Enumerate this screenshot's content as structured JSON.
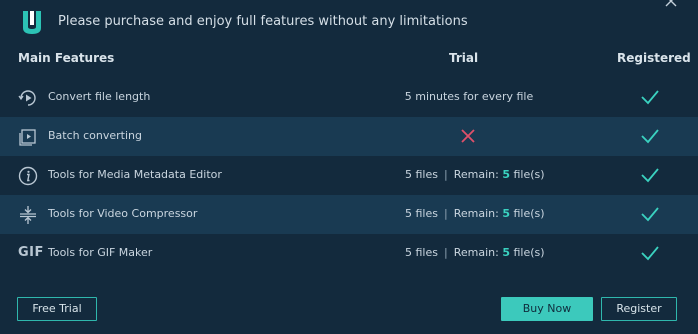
{
  "header": {
    "message": "Please purchase and enjoy full features without any limitations",
    "logo_icon": "app-logo-icon",
    "close_icon": "close-icon"
  },
  "columns": {
    "main": "Main Features",
    "trial": "Trial",
    "registered": "Registered"
  },
  "rows": [
    {
      "label": "Convert file length",
      "icon": "play-circle-icon",
      "trial": "5 minutes for every file",
      "registered": "check"
    },
    {
      "label": "Batch converting",
      "icon": "batch-icon",
      "trial": "not-available",
      "registered": "check"
    },
    {
      "label": "Tools for Media Metadata Editor",
      "icon": "info-icon",
      "trial_files": "5 files",
      "trial_remain": "Remain:",
      "trial_num": "5",
      "trial_unit": "file(s)",
      "registered": "check"
    },
    {
      "label": "Tools for Video Compressor",
      "icon": "compress-icon",
      "trial_files": "5 files",
      "trial_remain": "Remain:",
      "trial_num": "5",
      "trial_unit": "file(s)",
      "registered": "check"
    },
    {
      "label": "Tools for GIF Maker",
      "icon": "gif-icon",
      "icon_text": "GIF",
      "trial_files": "5 files",
      "trial_remain": "Remain:",
      "trial_num": "5",
      "trial_unit": "file(s)",
      "registered": "check"
    }
  ],
  "trial_separator": "|",
  "buttons": {
    "free_trial": "Free Trial",
    "buy_now": "Buy Now",
    "register": "Register"
  },
  "colors": {
    "background": "#132a3d",
    "row_alt": "#193a52",
    "accent": "#3cc9bc",
    "check": "#3ad2c0",
    "cross": "#e0506a"
  }
}
